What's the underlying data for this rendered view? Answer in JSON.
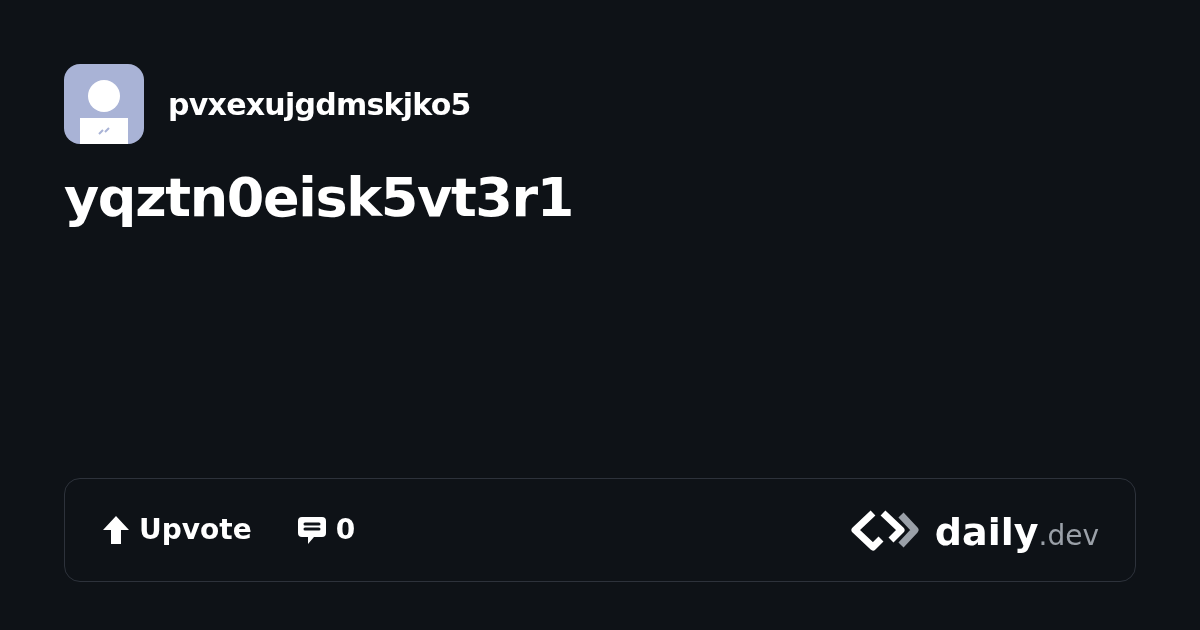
{
  "author": {
    "username": "pvxexujgdmskjko5"
  },
  "post": {
    "title": "yqztn0eisk5vt3r1"
  },
  "footer": {
    "upvote_label": "Upvote",
    "comment_count": "0",
    "logo": {
      "name": "daily",
      "suffix": ".dev"
    }
  }
}
